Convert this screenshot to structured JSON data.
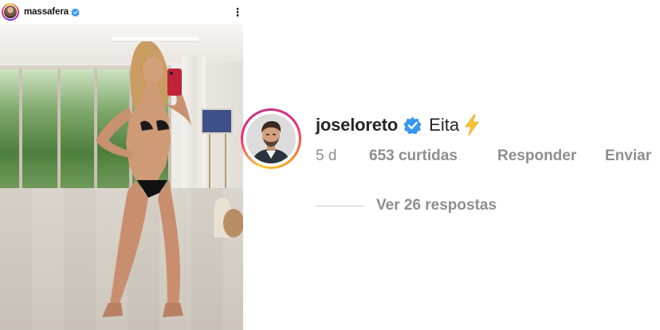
{
  "post": {
    "username": "massafera",
    "verified": true,
    "more_icon": "more-vertical-icon"
  },
  "comment": {
    "username": "joseloreto",
    "verified": true,
    "text": "Eita",
    "emoji": "high-voltage-emoji",
    "time": "5 d",
    "likes": "653 curtidas",
    "reply_label": "Responder",
    "send_label": "Enviar",
    "view_replies": "Ver 26 respostas"
  },
  "colors": {
    "verified_blue": "#3897f0",
    "meta_gray": "#8e8e8e",
    "text_dark": "#262626",
    "emoji_yellow": "#f7c531"
  }
}
